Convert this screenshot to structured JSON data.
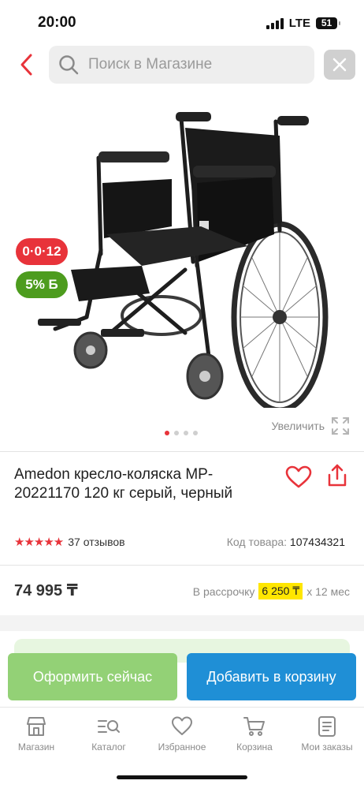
{
  "status_bar": {
    "time": "20:00",
    "network": "LTE",
    "battery": "51"
  },
  "header": {
    "back_icon": "chevron-left-icon",
    "search_placeholder": "Поиск в Магазине",
    "search_icon": "search-icon",
    "clear_icon": "close-icon"
  },
  "gallery": {
    "badge_installment": "0·0·12",
    "badge_bonus": "5% Б",
    "zoom_label": "Увеличить",
    "dots_count": 4,
    "active_dot": 0
  },
  "product": {
    "title": "Amedon кресло-коляска MP-20221170 120 кг серый, черный",
    "rating": 5,
    "reviews": "37 отзывов",
    "code_label": "Код товара:",
    "code_value": "107434321",
    "price": "74 995 ₸",
    "installment_label": "В рассрочку",
    "installment_amount": "6 250 ₸",
    "installment_term": "x 12 мес"
  },
  "actions": {
    "buy_now": "Оформить сейчас",
    "add_to_cart": "Добавить в корзину"
  },
  "tabbar": {
    "items": [
      {
        "label": "Магазин",
        "icon": "shop-icon"
      },
      {
        "label": "Каталог",
        "icon": "catalog-icon"
      },
      {
        "label": "Избранное",
        "icon": "heart-icon"
      },
      {
        "label": "Корзина",
        "icon": "cart-icon"
      },
      {
        "label": "Мои заказы",
        "icon": "orders-icon"
      }
    ]
  },
  "colors": {
    "accent_red": "#e8333a",
    "bonus_green": "#4d9c1e",
    "buy_green": "#93d176",
    "cart_blue": "#1f8fd6",
    "highlight_yellow": "#ffe600"
  }
}
